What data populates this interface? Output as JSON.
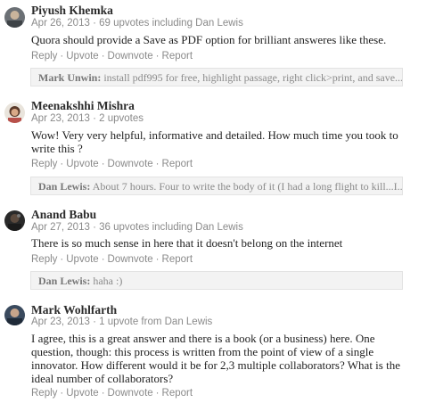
{
  "comments": [
    {
      "author": "Piyush Khemka",
      "date": "Apr 26, 2013",
      "upvotes": "69 upvotes including Dan Lewis",
      "text": "Quora should provide a Save as PDF option for brilliant answeres like these.",
      "reply_author": "Mark Unwin",
      "reply_text": "install pdf995 for free, highlight passage, right click>print, and save..."
    },
    {
      "author": "Meenakshhi Mishra",
      "date": "Apr 23, 2013",
      "upvotes": "2 upvotes",
      "text": "Wow! Very very helpful, informative and detailed. How much time you took to write this ?",
      "reply_author": "Dan Lewis",
      "reply_text": "About 7 hours. Four to write the body of it (I had a long flight to kill...I..."
    },
    {
      "author": "Anand Babu",
      "date": "Apr 27, 2013",
      "upvotes": "36 upvotes including Dan Lewis",
      "text": "There is so much sense in here that it doesn't belong on the internet",
      "reply_author": "Dan Lewis",
      "reply_text": "haha :)"
    },
    {
      "author": "Mark Wohlfarth",
      "date": "Apr 23, 2013",
      "upvotes": "1 upvote from Dan Lewis",
      "text": "I agree, this is a great answer and there is a book (or a business) here.  One question, though: this process is written from the point of view of a single innovator.  How different would it be for 2,3 multiple collaborators?  What is the ideal number of collaborators?"
    }
  ],
  "actions": {
    "reply": "Reply",
    "upvote": "Upvote",
    "downvote": "Downvote",
    "report": "Report",
    "separator": "·",
    "meta_separator": "·"
  },
  "reply_colon": ":"
}
